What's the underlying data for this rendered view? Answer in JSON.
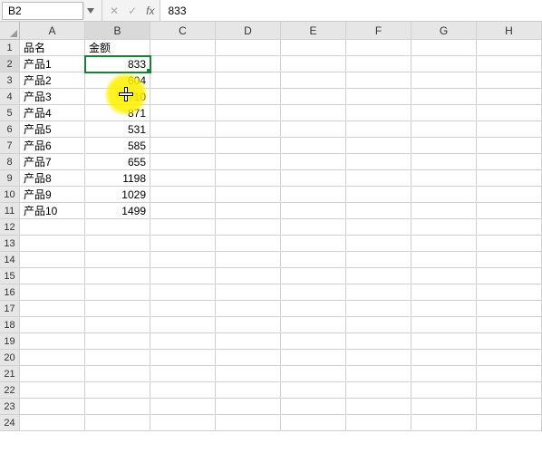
{
  "namebox": {
    "cell_ref": "B2"
  },
  "formula_bar": {
    "cancel_glyph": "✕",
    "confirm_glyph": "✓",
    "fx_label": "fx",
    "value": "833"
  },
  "columns": [
    "A",
    "B",
    "C",
    "D",
    "E",
    "F",
    "G",
    "H"
  ],
  "active_col_index": 1,
  "active_row_index": 1,
  "total_rows": 24,
  "headers": {
    "A": "品名",
    "B": "金额"
  },
  "data_rows": [
    {
      "A": "产品1",
      "B": 833
    },
    {
      "A": "产品2",
      "B": 604
    },
    {
      "A": "产品3",
      "B": 1710
    },
    {
      "A": "产品4",
      "B": 871
    },
    {
      "A": "产品5",
      "B": 531
    },
    {
      "A": "产品6",
      "B": 585
    },
    {
      "A": "产品7",
      "B": 655
    },
    {
      "A": "产品8",
      "B": 1198
    },
    {
      "A": "产品9",
      "B": 1029
    },
    {
      "A": "产品10",
      "B": 1499
    }
  ],
  "chart_data": {
    "type": "table",
    "title": "",
    "columns": [
      "品名",
      "金额"
    ],
    "rows": [
      [
        "产品1",
        833
      ],
      [
        "产品2",
        604
      ],
      [
        "产品3",
        1710
      ],
      [
        "产品4",
        871
      ],
      [
        "产品5",
        531
      ],
      [
        "产品6",
        585
      ],
      [
        "产品7",
        655
      ],
      [
        "产品8",
        1198
      ],
      [
        "产品9",
        1029
      ],
      [
        "产品10",
        1499
      ]
    ]
  },
  "cursor": {
    "row": 4,
    "col": 1
  },
  "colors": {
    "selection_border": "#1a7f37",
    "highlight": "#fff000"
  }
}
